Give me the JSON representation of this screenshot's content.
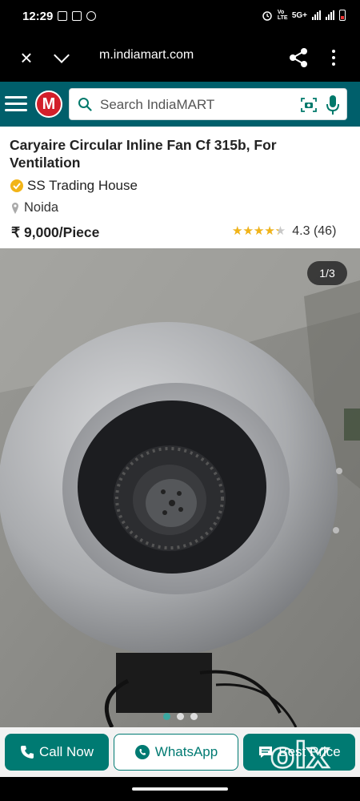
{
  "status_bar": {
    "time": "12:29",
    "network_label": "5G+",
    "volte_label": "Vo LTE"
  },
  "browser": {
    "url": "m.indiamart.com"
  },
  "header": {
    "logo_text": "M",
    "search_placeholder": "Search IndiaMART"
  },
  "product": {
    "title": "Caryaire Circular Inline Fan Cf 315b, For Ventilation",
    "seller": "SS Trading House",
    "location": "Noida",
    "price": "₹ 9,000/Piece",
    "rating_value": 4.3,
    "rating_text": "4.3 (46)",
    "stars_text": "★★★★★"
  },
  "gallery": {
    "counter": "1/3",
    "current_index": 1,
    "total": 3
  },
  "actions": {
    "call_label": "Call Now",
    "whatsapp_label": "WhatsApp",
    "best_price_label": "Best Price"
  },
  "watermark": {
    "text": "olx"
  },
  "colors": {
    "brand_teal": "#007a72",
    "header_teal": "#005f6b",
    "star_gold": "#f2b417",
    "logo_red": "#d21f2a"
  },
  "icons": {
    "close": "close-icon",
    "chevron": "chevron-down-icon",
    "share": "share-icon",
    "more": "more-vert-icon",
    "menu": "hamburger-icon",
    "search": "search-icon",
    "camera": "camera-search-icon",
    "mic": "mic-icon",
    "verified": "verified-badge-icon",
    "pin": "location-pin-icon",
    "phone": "phone-icon",
    "whatsapp": "whatsapp-icon",
    "chat": "chat-icon"
  }
}
